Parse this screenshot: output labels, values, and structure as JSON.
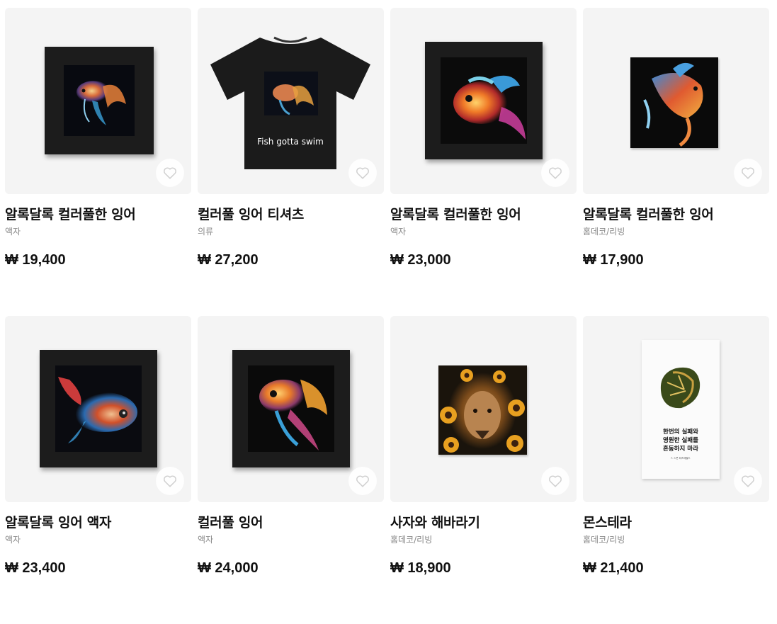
{
  "currency": "₩",
  "products": [
    {
      "title": "알록달록 컬러풀한 잉어",
      "category": "액자",
      "price": "₩ 19,400",
      "art": "fish-framed-small"
    },
    {
      "title": "컬러풀 잉어 티셔츠",
      "category": "의류",
      "price": "₩ 27,200",
      "art": "fish-tshirt",
      "tee_text": "Fish gotta swim"
    },
    {
      "title": "알록달록 컬러풀한 잉어",
      "category": "액자",
      "price": "₩ 23,000",
      "art": "fish-framed-orange"
    },
    {
      "title": "알록달록 컬러풀한 잉어",
      "category": "홈데코/리빙",
      "price": "₩ 17,900",
      "art": "fish-tapestry"
    },
    {
      "title": "알록달록 잉어 액자",
      "category": "액자",
      "price": "₩ 23,400",
      "art": "fish-framed-blue"
    },
    {
      "title": "컬러풀 잉어",
      "category": "액자",
      "price": "₩ 24,000",
      "art": "fish-framed-gold"
    },
    {
      "title": "사자와 해바라기",
      "category": "홈데코/리빙",
      "price": "₩ 18,900",
      "art": "lion-tapestry"
    },
    {
      "title": "몬스테라",
      "category": "홈데코/리빙",
      "price": "₩ 21,400",
      "art": "monstera-tapestry",
      "poster_text": [
        "한번의 실패와",
        "영원한 실패를",
        "혼동하지 마라"
      ],
      "poster_caption": "F. 스콧 피츠제럴드"
    }
  ],
  "icons": {
    "wishlist": "heart-outline-icon"
  },
  "colors": {
    "thumb_bg": "#f4f4f4",
    "frame": "#1c1c1c",
    "category_text": "#888888"
  }
}
